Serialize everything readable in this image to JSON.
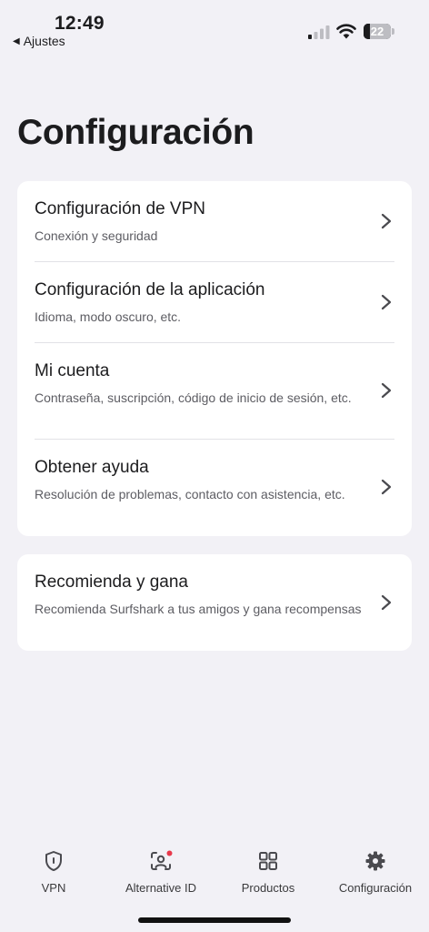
{
  "status_bar": {
    "time": "12:49",
    "back_label": "Ajustes",
    "battery_level": 22,
    "battery_text": "22"
  },
  "page": {
    "title": "Configuración"
  },
  "settings_group": [
    {
      "title": "Configuración de VPN",
      "subtitle": "Conexión y seguridad"
    },
    {
      "title": "Configuración de la aplicación",
      "subtitle": "Idioma, modo oscuro, etc."
    },
    {
      "title": "Mi cuenta",
      "subtitle": "Contraseña, suscripción, código de inicio de sesión, etc."
    },
    {
      "title": "Obtener ayuda",
      "subtitle": "Resolución de problemas, contacto con asistencia, etc."
    }
  ],
  "referral": {
    "title": "Recomienda y gana",
    "subtitle": "Recomienda Surfshark a tus amigos y gana recompensas"
  },
  "tab_bar": {
    "tabs": [
      {
        "label": "VPN",
        "icon": "shield-icon"
      },
      {
        "label": "Alternative ID",
        "icon": "person-scan-icon",
        "badge": true
      },
      {
        "label": "Productos",
        "icon": "grid-icon"
      },
      {
        "label": "Configuración",
        "icon": "gear-icon"
      }
    ]
  },
  "colors": {
    "background": "#f2f1f6",
    "card": "#ffffff",
    "text": "#1c1c1e",
    "subtext": "#5d5d63",
    "icon": "#4a4a4f",
    "badge": "#e8394b"
  }
}
